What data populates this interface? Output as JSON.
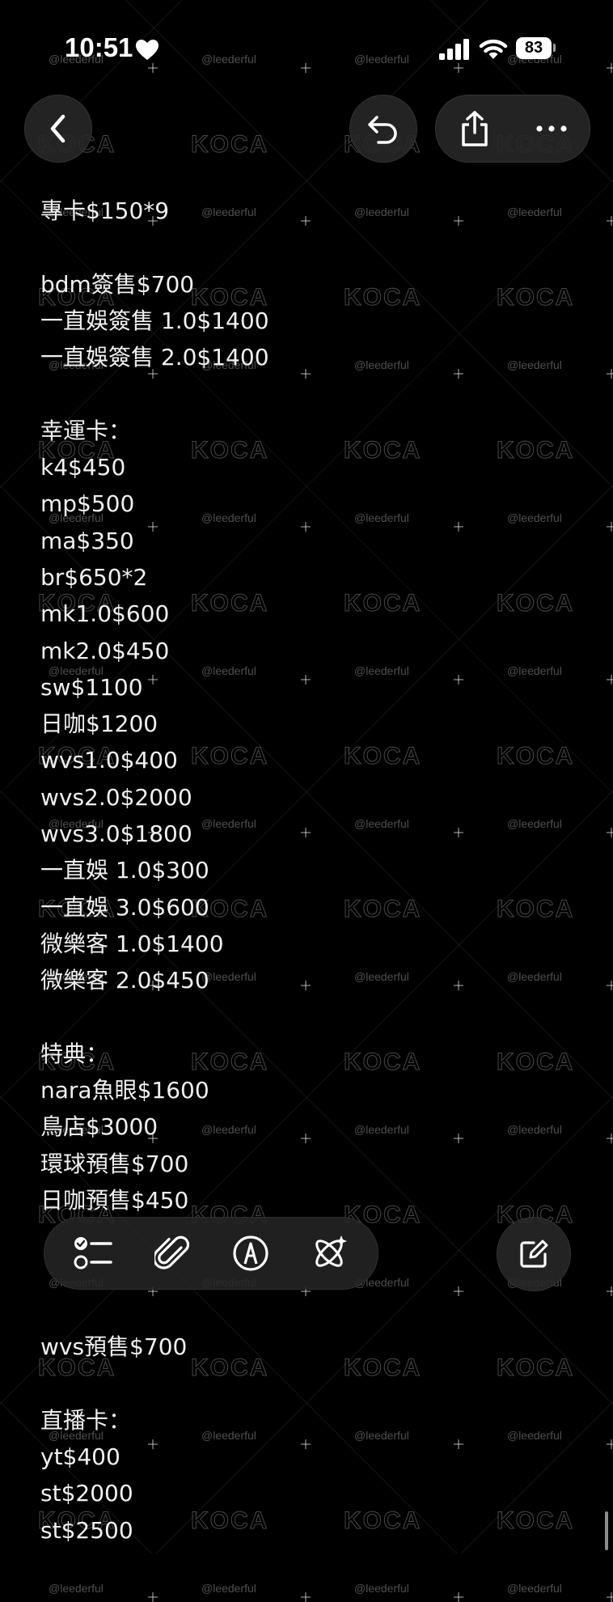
{
  "status_bar": {
    "time": "10:51",
    "battery_level": "83",
    "icons": [
      "heart-icon",
      "signal-icon",
      "wifi-icon",
      "battery-icon"
    ]
  },
  "nav": {
    "icons": [
      "chevron-left-icon",
      "undo-icon",
      "share-icon",
      "more-icon"
    ]
  },
  "watermark": {
    "logo": "KOCA",
    "handle": "@leederful"
  },
  "note": {
    "lines": [
      "專卡$150*9",
      "",
      "bdm簽售$700",
      "一直娛簽售 1.0$1400",
      "一直娛簽售 2.0$1400",
      "",
      "幸運卡：",
      "k4$450",
      "mp$500",
      "ma$350",
      "br$650*2",
      "mk1.0$600",
      "mk2.0$450",
      "sw$1100",
      "日咖$1200",
      "wvs1.0$400",
      "wvs2.0$2000",
      "wvs3.0$1800",
      "一直娛 1.0$300",
      "一直娛 3.0$600",
      "微樂客 1.0$1400",
      "微樂客 2.0$450",
      "",
      "特典：",
      "nara魚眼$1600",
      "鳥店$3000",
      "環球預售$700",
      "日咖預售$450",
      "",
      "",
      "",
      "wvs預售$700",
      "",
      "直播卡：",
      "yt$400",
      "st$2000",
      "st$2500"
    ]
  },
  "toolbar": {
    "icons": [
      "checklist-icon",
      "paperclip-icon",
      "pen-markup-icon",
      "ai-sparkle-icon",
      "compose-icon"
    ]
  },
  "colors": {
    "background": "#000000",
    "text": "#f0f0f0",
    "button_bg": "#282828"
  }
}
